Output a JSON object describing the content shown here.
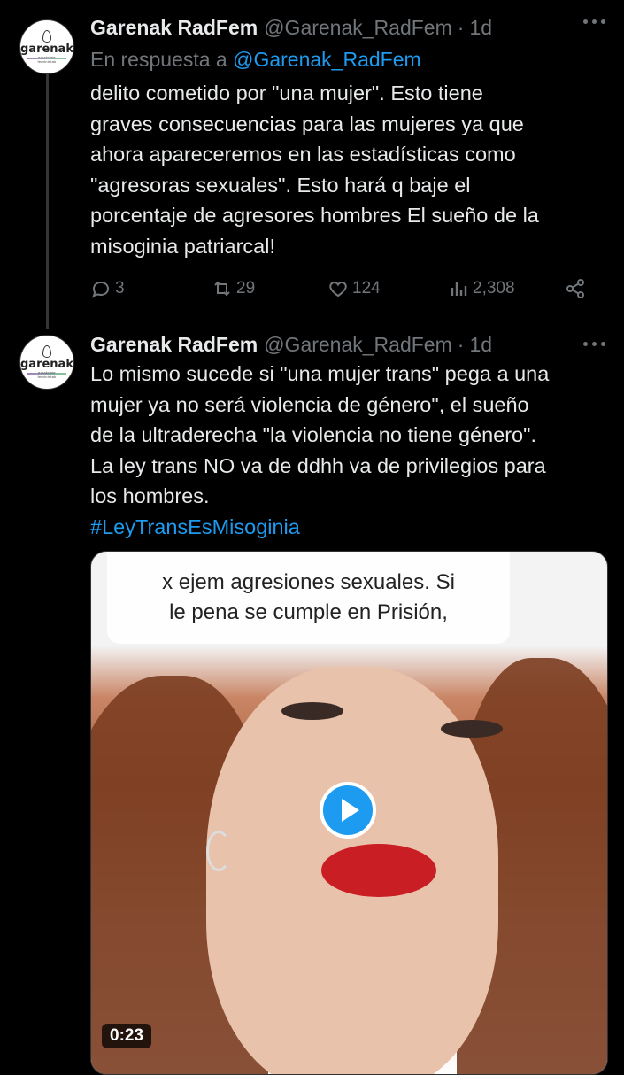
{
  "tweets": [
    {
      "avatar": {
        "brand": "garenak",
        "sub1": "emakume",
        "sub2": "feministak"
      },
      "display_name": "Garenak RadFem",
      "handle": "@Garenak_RadFem",
      "separator": "·",
      "time": "1d",
      "reply_prefix": "En respuesta a",
      "reply_mention": "@Garenak_RadFem",
      "text_lines": [
        "delito cometido por \"una mujer\". Esto tiene",
        "graves consecuencias para las mujeres ya que",
        "ahora apareceremos en las estadísticas como",
        "\"agresoras sexuales\". Esto hará  q baje el",
        "porcentaje de agresores hombres El sueño de la",
        "misoginia patriarcal!"
      ],
      "actions": {
        "replies": "3",
        "reposts": "29",
        "likes": "124",
        "views": "2,308"
      },
      "icons": {
        "more": "more-icon",
        "reply": "reply-icon",
        "repost": "repost-icon",
        "like": "heart-icon",
        "views": "views-icon",
        "share": "share-icon"
      }
    },
    {
      "avatar": {
        "brand": "garenak",
        "sub1": "emakume",
        "sub2": "feministak"
      },
      "display_name": "Garenak RadFem",
      "handle": "@Garenak_RadFem",
      "separator": "·",
      "time": "1d",
      "text_lines": [
        "Lo mismo sucede si \"una mujer trans\" pega a una",
        "mujer ya no será violencia de género\", el sueño",
        "de la ultraderecha \"la violencia no tiene género\".",
        "La ley trans NO va de ddhh va de privilegios para",
        "los hombres."
      ],
      "hashtag": "#LeyTransEsMisoginia",
      "media": {
        "caption_lines": [
          "x ejem agresiones sexuales. Si",
          "le pena se cumple en Prisión,"
        ],
        "duration": "0:23"
      }
    }
  ],
  "colors": {
    "background": "#000000",
    "text": "#e7e9ea",
    "muted": "#71767b",
    "accent": "#1d9bf0"
  }
}
